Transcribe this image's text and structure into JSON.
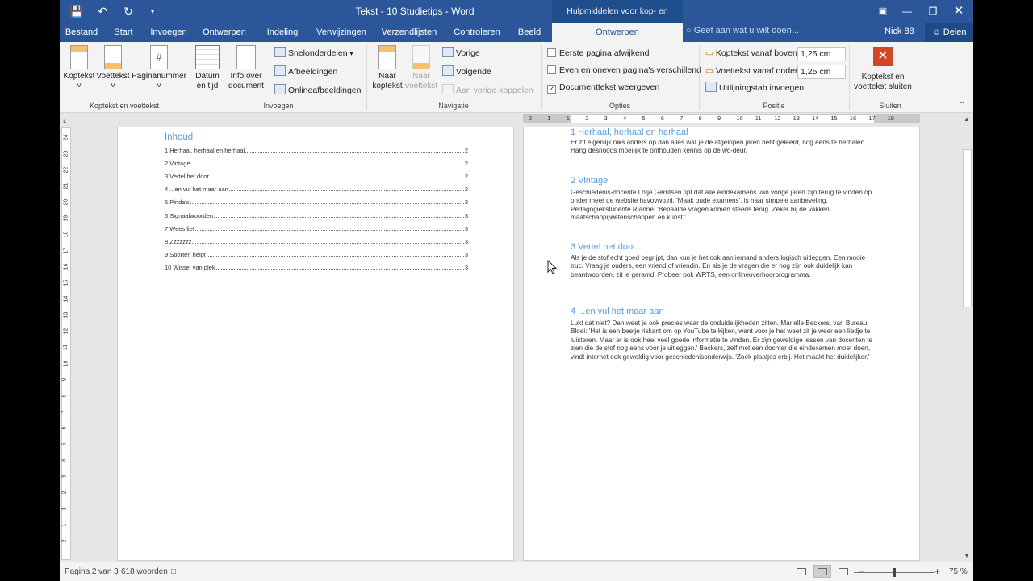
{
  "window": {
    "title": "Tekst - 10 Studietips - Word",
    "context_title": "Hulpmiddelen voor kop- en voetteksten"
  },
  "tabs": [
    "Bestand",
    "Start",
    "Invoegen",
    "Ontwerpen",
    "Indeling",
    "Verwijzingen",
    "Verzendlijsten",
    "Controleren",
    "Beeld",
    "Ontwerpen"
  ],
  "active_tab_index": 9,
  "tell_me": "Geef aan wat u wilt doen...",
  "user": "Nick 88",
  "share": "Delen",
  "ribbon": {
    "groups": {
      "header_footer": "Koptekst en voettekst",
      "insert": "Invoegen",
      "navigation": "Navigatie",
      "options": "Opties",
      "position": "Positie",
      "close": "Sluiten"
    },
    "header_btn": "Koptekst",
    "footer_btn": "Voettekst",
    "pagenum_btn": "Paginanummer",
    "date_btn": "Datum en tijd",
    "docinfo_btn": "Info over document",
    "quickparts": "Snelonderdelen",
    "pictures": "Afbeeldingen",
    "online_pictures": "Onlineafbeeldingen",
    "goto_header": "Naar koptekst",
    "goto_footer": "Naar voettekst",
    "previous": "Vorige",
    "next": "Volgende",
    "link_previous": "Aan vorige koppelen",
    "opt_first_page": "Eerste pagina afwijkend",
    "opt_odd_even": "Even en oneven pagina's verschillend",
    "opt_show_text": "Documenttekst weergeven",
    "opt_show_text_checked": true,
    "header_from_top_label": "Koptekst vanaf boven:",
    "header_from_top": "1,25 cm",
    "footer_from_bottom_label": "Voettekst vanaf onder:",
    "footer_from_bottom": "1,25 cm",
    "align_tab": "Uitlijningstab invoegen",
    "close_line1": "Koptekst en",
    "close_line2": "voettekst sluiten"
  },
  "toc": {
    "title": "Inhoud",
    "entries": [
      {
        "text": "1 Herhaal, herhaal en herhaal",
        "page": "2"
      },
      {
        "text": "2 Vintage",
        "page": "2"
      },
      {
        "text": "3 Vertel het door...",
        "page": "2"
      },
      {
        "text": "4 ...en vul het maar aan",
        "page": "2"
      },
      {
        "text": "5 Pinda's",
        "page": "3"
      },
      {
        "text": "6 Signaalwoorden",
        "page": "3"
      },
      {
        "text": "7 Wees lief",
        "page": "3"
      },
      {
        "text": "8 Zzzzzzz",
        "page": "3"
      },
      {
        "text": "9 Sporten helpt",
        "page": "3"
      },
      {
        "text": "10 Wissel van plek",
        "page": "3"
      }
    ]
  },
  "sections": [
    {
      "heading": "1 Herhaal, herhaal en herhaal",
      "body": "Er zit eigenlijk niks anders op dan alles wat je de afgelopen jaren hebt geleerd, nog eens te herhalen. Hang desnoods moeilijk te onthouden kennis op de wc-deur."
    },
    {
      "heading": "2 Vintage",
      "body": "Geschiedenis-docente Lotje Gerritsen tipt dat alle eindexamens van vorige jaren zijn terug te vinden op onder meer de website havovwo.nl. 'Maak oude examens', is haar simpele aanbeveling. Pedagogiekstudente Rianne: 'Bepaalde vragen komen steeds terug. Zeker bij de vakken maatschappijwetenschappen en kunst.'"
    },
    {
      "heading": "3 Vertel het door...",
      "body": "Als je de stof echt goed begrijpt, dan kun je het ook aan iemand anders logisch uitleggen. Een mooie truc. Vraag je ouders, een vriend of vriendin. En als je de vragen die er nog zijn ook duidelijk kan beantwoorden, zit je geramd. Probeer ook WRTS, een onlineoverhoorprogramma."
    },
    {
      "heading": "4 ...en vul het maar aan",
      "body": "Lukt dat niet? Dan weet je ook precies waar de onduidelijkheden zitten. Marielle Beckers, van Bureau Bloei: 'Het is een beetje riskant om op YouTube te kijken, want voor je het weet zit je weer een liedje te luisteren. Maar er is ook heel veel goede informatie te vinden. Er zijn geweldige lessen van docenten te zien die de stof nog eens voor je uitleggen.' Beckers, zelf met een dochter die eindexamen moet doen, vindt internet ook geweldig voor geschiedenisonderwijs. 'Zoek plaatjes erbij. Het maakt het duidelijker.'"
    }
  ],
  "ruler_h": [
    "2",
    "1",
    "1",
    "2",
    "3",
    "4",
    "5",
    "6",
    "7",
    "8",
    "9",
    "10",
    "11",
    "12",
    "13",
    "14",
    "15",
    "16",
    "17",
    "18"
  ],
  "ruler_v": [
    "2",
    "1",
    "1",
    "2",
    "3",
    "4",
    "5",
    "6",
    "7",
    "8",
    "9",
    "10",
    "11",
    "12",
    "13",
    "14",
    "15",
    "16",
    "17",
    "18",
    "19",
    "20",
    "21",
    "22",
    "23",
    "24"
  ],
  "status": {
    "page": "Pagina 2 van 3",
    "words": "618 woorden",
    "zoom": "75 %",
    "zoom_fraction": 0.5,
    "zoom_minus": "–",
    "zoom_plus": "+"
  },
  "colors": {
    "brand": "#2b579a",
    "heading": "#5b9bd5",
    "close_red": "#d24726"
  }
}
